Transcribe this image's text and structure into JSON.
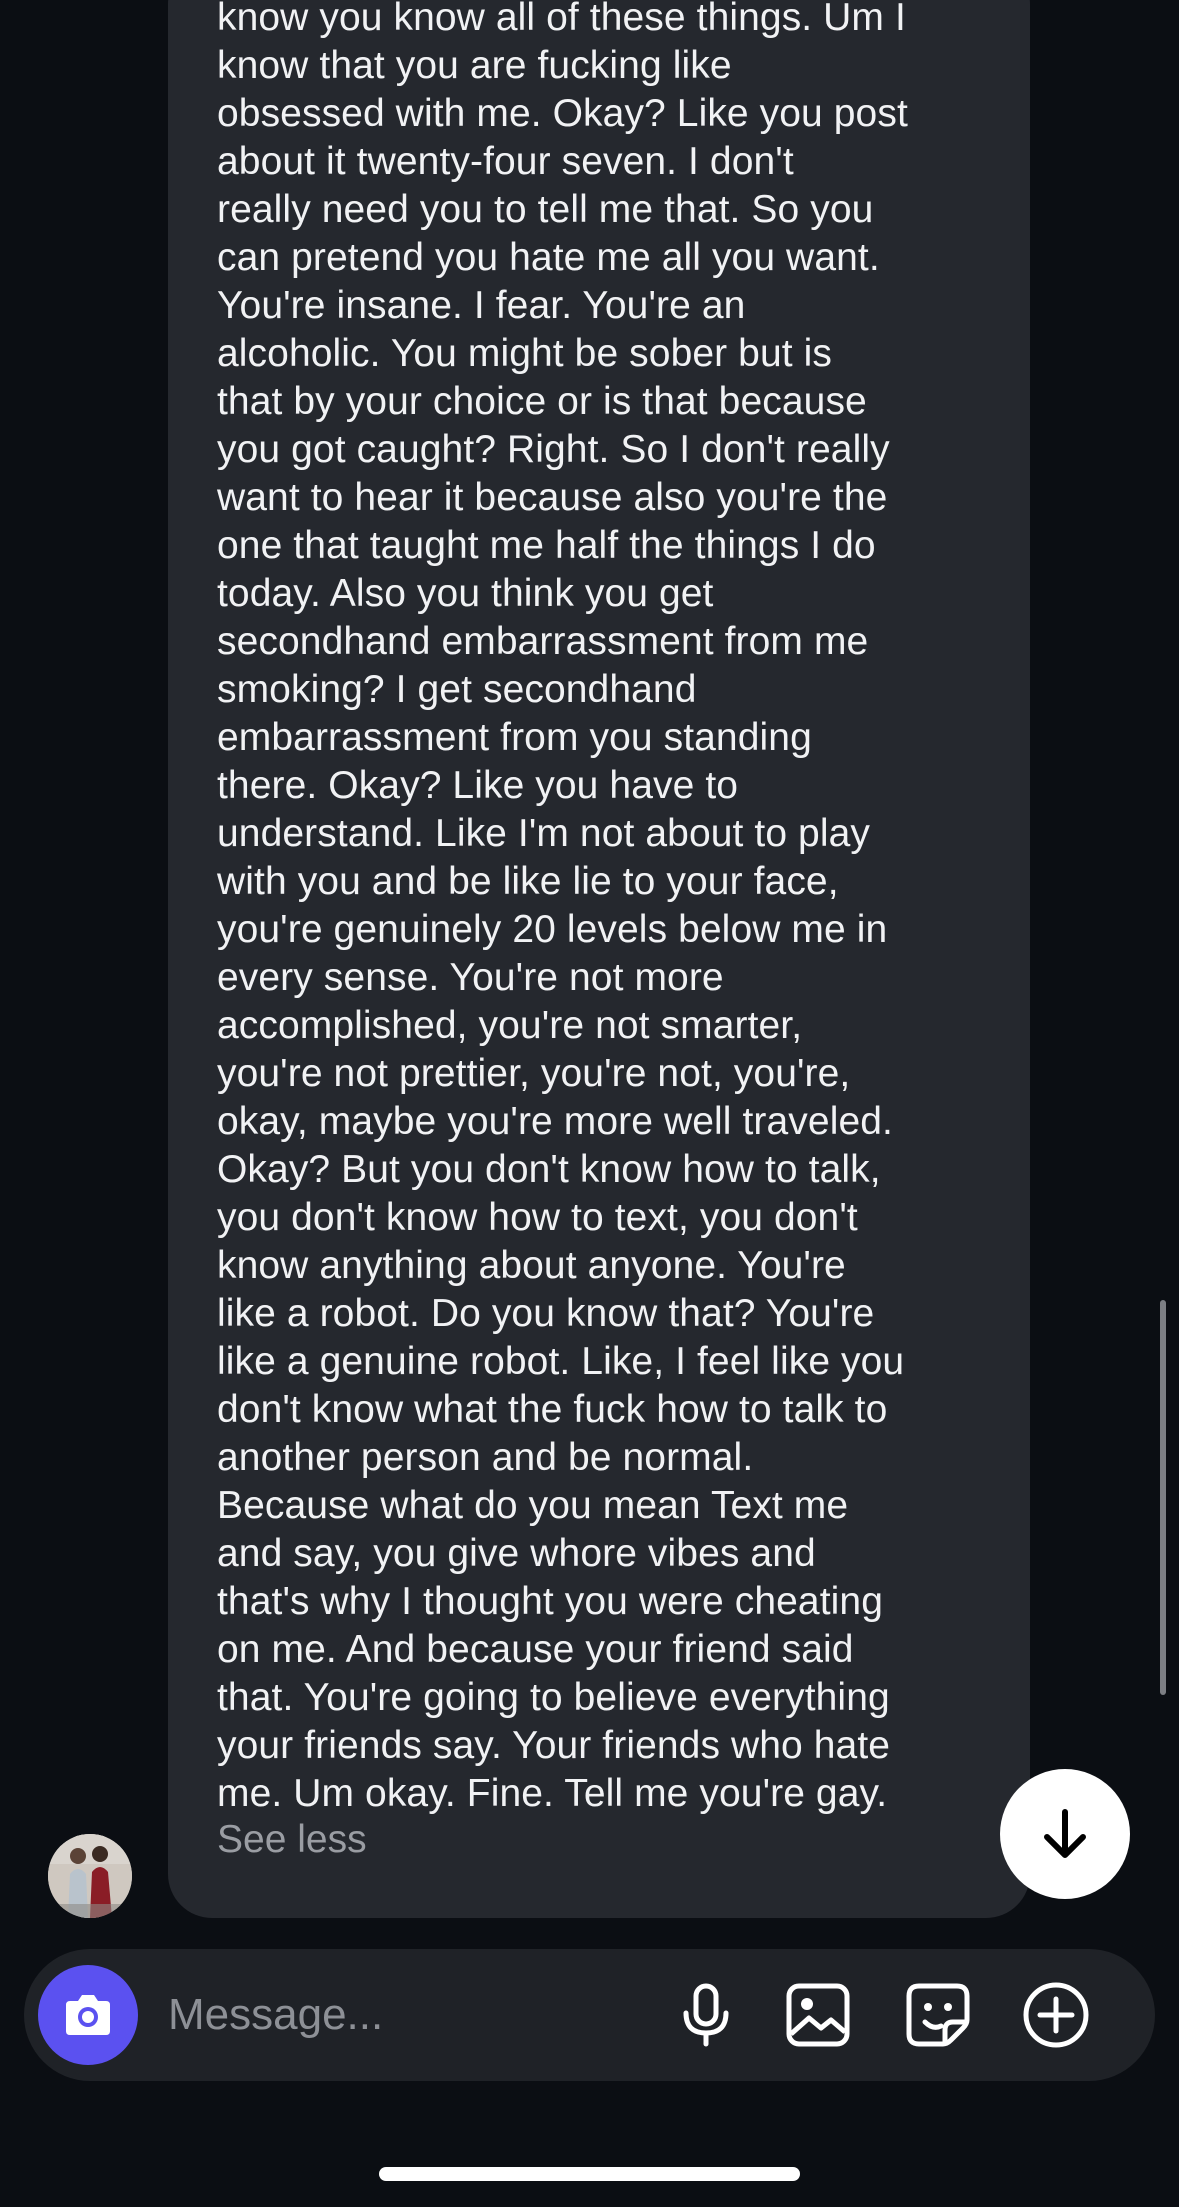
{
  "message": {
    "lines": [
      "know you know all of these things. Um I",
      "know that you are fucking like",
      "obsessed with me. Okay? Like you post",
      "about it twenty-four seven. I don't",
      "really need you to tell me that. So you",
      "can pretend you hate me all you want.",
      "You're insane. I fear. You're an",
      "alcoholic. You might be sober but is",
      "that by your choice or is that because",
      "you got caught? Right. So I don't really",
      "want to hear it because also you're the",
      "one that taught me half the things I do",
      "today. Also you think you get",
      "secondhand embarrassment from me",
      "smoking? I get secondhand",
      "embarrassment from you standing",
      "there. Okay? Like you have to",
      "understand. Like I'm not about to play",
      "with you and be like lie to your face,",
      "you're genuinely 20 levels below me in",
      "every sense. You're not more",
      "accomplished, you're not smarter,",
      "you're not prettier, you're not, you're,",
      "okay, maybe you're more well traveled.",
      "Okay? But you don't know how to talk,",
      "you don't know how to text, you don't",
      "know anything about anyone. You're",
      "like a robot. Do you know that? You're",
      "like a genuine robot. Like, I feel like you",
      "don't know what the fuck how to talk to",
      "another person and be normal.",
      "Because what do you mean Text me",
      "and say, you give whore vibes and",
      "that's why I thought you were cheating",
      "on me. And because your friend said",
      "that. You're going to believe everything",
      "your friends say. Your friends who hate",
      "me. Um okay. Fine. Tell me you're gay."
    ],
    "see_less_label": "See less"
  },
  "composer": {
    "placeholder": "Message..."
  },
  "icons": {
    "camera": "camera-icon",
    "microphone": "microphone-icon",
    "gallery": "image-icon",
    "sticker": "sticker-icon",
    "add": "plus-circle-icon",
    "jump_down": "arrow-down-icon"
  },
  "colors": {
    "background": "#0b0e13",
    "bubble": "#25282e",
    "text": "#f1f2f4",
    "muted_text": "#9a9da3",
    "camera_accent": "#5b51f0",
    "composer": "#1f2227"
  }
}
